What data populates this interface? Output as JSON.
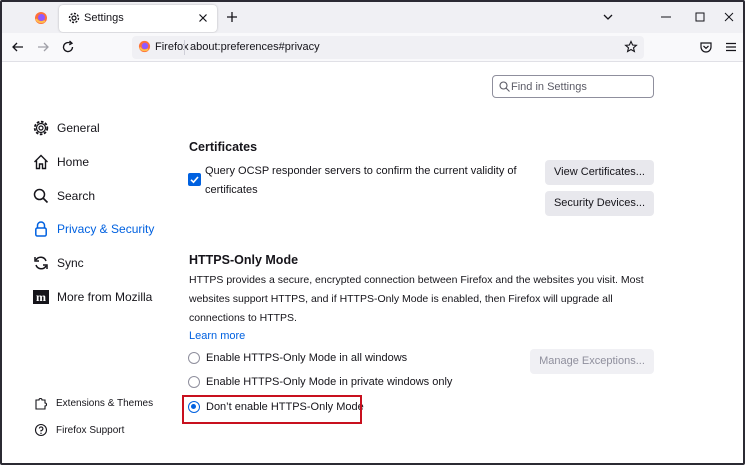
{
  "browser": {
    "tab_title": "Settings",
    "identity_label": "Firefox",
    "url": "about:preferences#privacy"
  },
  "search": {
    "placeholder": "Find in Settings"
  },
  "sidebar": {
    "items": [
      {
        "label": "General",
        "icon": "gear-icon"
      },
      {
        "label": "Home",
        "icon": "home-icon"
      },
      {
        "label": "Search",
        "icon": "search-icon"
      },
      {
        "label": "Privacy & Security",
        "icon": "lock-icon",
        "active": true
      },
      {
        "label": "Sync",
        "icon": "sync-icon"
      },
      {
        "label": "More from Mozilla",
        "icon": "mozilla-icon"
      }
    ],
    "footer": [
      {
        "label": "Extensions & Themes",
        "icon": "puzzle-icon"
      },
      {
        "label": "Firefox Support",
        "icon": "help-icon"
      }
    ]
  },
  "certificates": {
    "heading": "Certificates",
    "ocsp_label": "Query OCSP responder servers to confirm the current validity of certificates",
    "ocsp_checked": true,
    "view_button": "View Certificates...",
    "devices_button": "Security Devices..."
  },
  "https_only": {
    "heading": "HTTPS-Only Mode",
    "description": "HTTPS provides a secure, encrypted connection between Firefox and the websites you visit. Most websites support HTTPS, and if HTTPS-Only Mode is enabled, then Firefox will upgrade all connections to HTTPS.",
    "learn_more": "Learn more",
    "manage_button": "Manage Exceptions...",
    "options": [
      {
        "label": "Enable HTTPS-Only Mode in all windows",
        "checked": false
      },
      {
        "label": "Enable HTTPS-Only Mode in private windows only",
        "checked": false
      },
      {
        "label": "Don’t enable HTTPS-Only Mode",
        "checked": true
      }
    ]
  },
  "colors": {
    "accent": "#0061e0",
    "highlight": "#c8101e"
  }
}
